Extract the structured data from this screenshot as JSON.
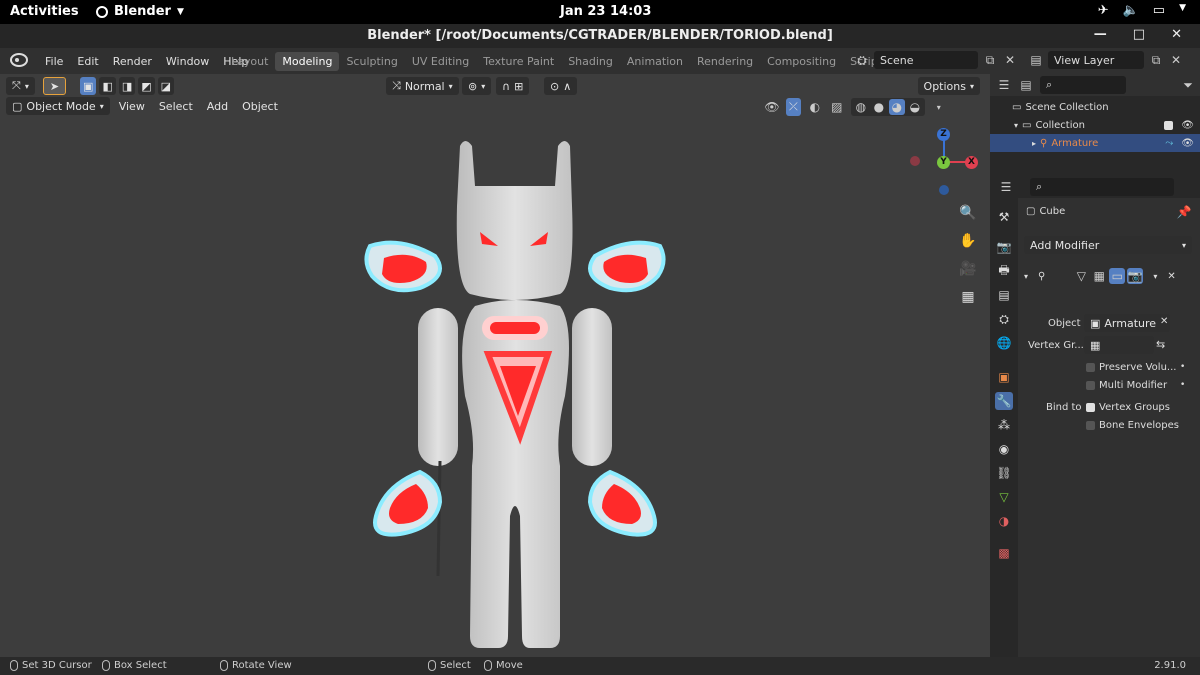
{
  "gnome": {
    "activities": "Activities",
    "app_name": "Blender",
    "clock": "Jan 23  14:03"
  },
  "window": {
    "title": "Blender* [/root/Documents/CGTRADER/BLENDER/TORIOD.blend]"
  },
  "menu": [
    "File",
    "Edit",
    "Render",
    "Window",
    "Help"
  ],
  "workspace_tabs": [
    {
      "label": "Layout",
      "active": false
    },
    {
      "label": "Modeling",
      "active": true
    },
    {
      "label": "Sculpting",
      "active": false
    },
    {
      "label": "UV Editing",
      "active": false
    },
    {
      "label": "Texture Paint",
      "active": false
    },
    {
      "label": "Shading",
      "active": false
    },
    {
      "label": "Animation",
      "active": false
    },
    {
      "label": "Rendering",
      "active": false
    },
    {
      "label": "Compositing",
      "active": false
    },
    {
      "label": "Scripting",
      "active": false
    }
  ],
  "scene": {
    "value": "Scene"
  },
  "view_layer": {
    "value": "View Layer"
  },
  "viewport": {
    "orientation": "Normal",
    "options": "Options",
    "mode": "Object Mode",
    "menus": [
      "View",
      "Select",
      "Add",
      "Object"
    ]
  },
  "gizmo": {
    "x": "X",
    "y": "Y",
    "z": "Z"
  },
  "outliner": {
    "scene_collection": "Scene Collection",
    "collection": "Collection",
    "armature": "Armature"
  },
  "properties": {
    "object_name": "Cube",
    "add_modifier": "Add Modifier",
    "object_label": "Object",
    "object_value": "Armature",
    "vertex_group_label": "Vertex Gr...",
    "preserve_volume": "Preserve Volu...",
    "multi_modifier": "Multi Modifier",
    "bind_to_label": "Bind to",
    "vertex_groups": "Vertex Groups",
    "vertex_groups_checked": true,
    "bone_envelopes": "Bone Envelopes",
    "bone_envelopes_checked": false
  },
  "status": {
    "set_cursor": "Set 3D Cursor",
    "box_select": "Box Select",
    "rotate_view": "Rotate View",
    "select": "Select",
    "move": "Move",
    "version": "2.91.0"
  },
  "colors": {
    "accent_blue": "#4a6fa8",
    "armature_orange": "#e88a4a",
    "glow_red": "#ff3030",
    "glow_cyan": "#8cecff",
    "body_grey": "#d4d4d4"
  }
}
